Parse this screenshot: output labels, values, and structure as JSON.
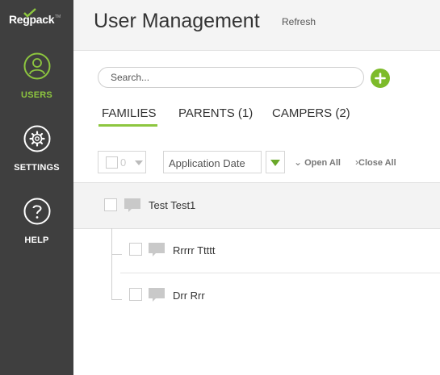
{
  "brand": {
    "logo_text": "Regpack",
    "trademark": "TM"
  },
  "sidebar": {
    "items": [
      {
        "label": "USERS",
        "icon": "user-icon",
        "active": true
      },
      {
        "label": "SETTINGS",
        "icon": "gear-icon",
        "active": false
      },
      {
        "label": "HELP",
        "icon": "question-icon",
        "active": false
      }
    ]
  },
  "header": {
    "title": "User Management",
    "refresh_label": "Refresh"
  },
  "search": {
    "placeholder": "Search...",
    "value": ""
  },
  "tabs": [
    {
      "label": "FAMILIES",
      "active": true
    },
    {
      "label": "PARENTS (1)",
      "active": false
    },
    {
      "label": "CAMPERS (2)",
      "active": false
    }
  ],
  "toolbar": {
    "selected_count": "0",
    "sort_field": "Application Date",
    "open_all_label": "Open All",
    "close_all_label": "Close All"
  },
  "list": {
    "family": {
      "name": "Test Test1"
    },
    "children": [
      {
        "name": "Rrrrr Ttttt"
      },
      {
        "name": "Drr Rrr"
      }
    ]
  },
  "colors": {
    "accent": "#8dc63f",
    "sidebar_bg": "#3f3f3f",
    "header_bg": "#f4f4f4"
  }
}
